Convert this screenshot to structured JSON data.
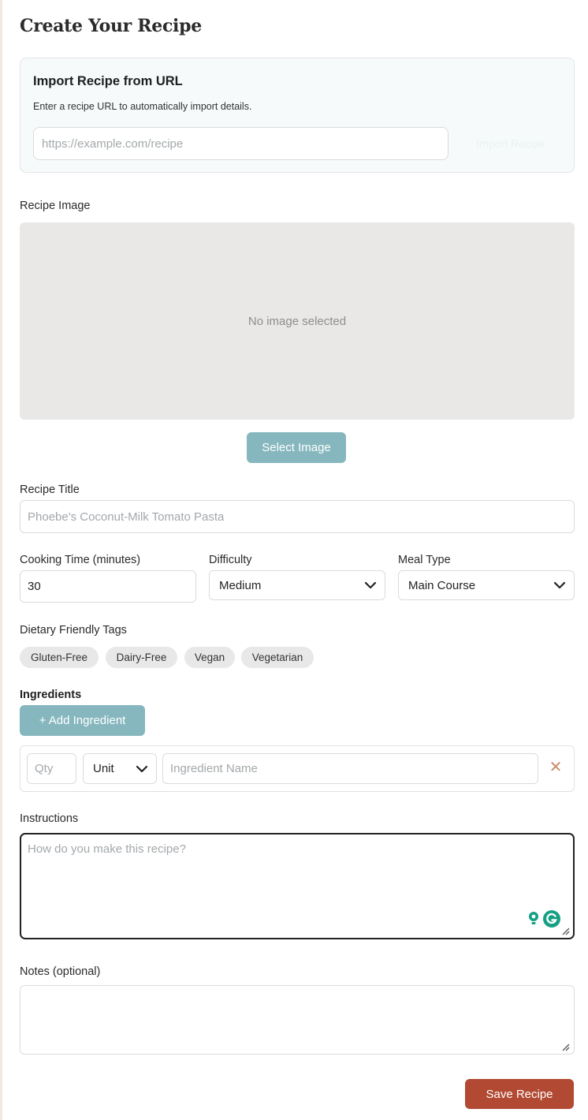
{
  "page": {
    "title": "Create Your Recipe"
  },
  "import": {
    "title": "Import Recipe from URL",
    "description": "Enter a recipe URL to automatically import details.",
    "url_placeholder": "https://example.com/recipe",
    "button_label": "Import Recipe"
  },
  "image": {
    "label": "Recipe Image",
    "empty_text": "No image selected",
    "select_button": "Select Image"
  },
  "title_field": {
    "label": "Recipe Title",
    "placeholder": "Phoebe's Coconut-Milk Tomato Pasta"
  },
  "cooking_time": {
    "label": "Cooking Time (minutes)",
    "value": "30"
  },
  "difficulty": {
    "label": "Difficulty",
    "value": "Medium"
  },
  "meal_type": {
    "label": "Meal Type",
    "value": "Main Course"
  },
  "tags": {
    "label": "Dietary Friendly Tags",
    "items": [
      "Gluten-Free",
      "Dairy-Free",
      "Vegan",
      "Vegetarian"
    ]
  },
  "ingredients": {
    "label": "Ingredients",
    "add_button": "+  Add Ingredient",
    "row": {
      "qty_placeholder": "Qty",
      "unit_value": "Unit",
      "name_placeholder": "Ingredient Name",
      "remove_symbol": "✕"
    }
  },
  "instructions": {
    "label": "Instructions",
    "placeholder": "How do you make this recipe?"
  },
  "notes": {
    "label": "Notes (optional)",
    "placeholder": ""
  },
  "save_button": "Save Recipe",
  "colors": {
    "accent_teal": "#86b7be",
    "save_red": "#b24a33",
    "remove_orange": "#c98b6b",
    "grammarly_green": "#15a085"
  }
}
